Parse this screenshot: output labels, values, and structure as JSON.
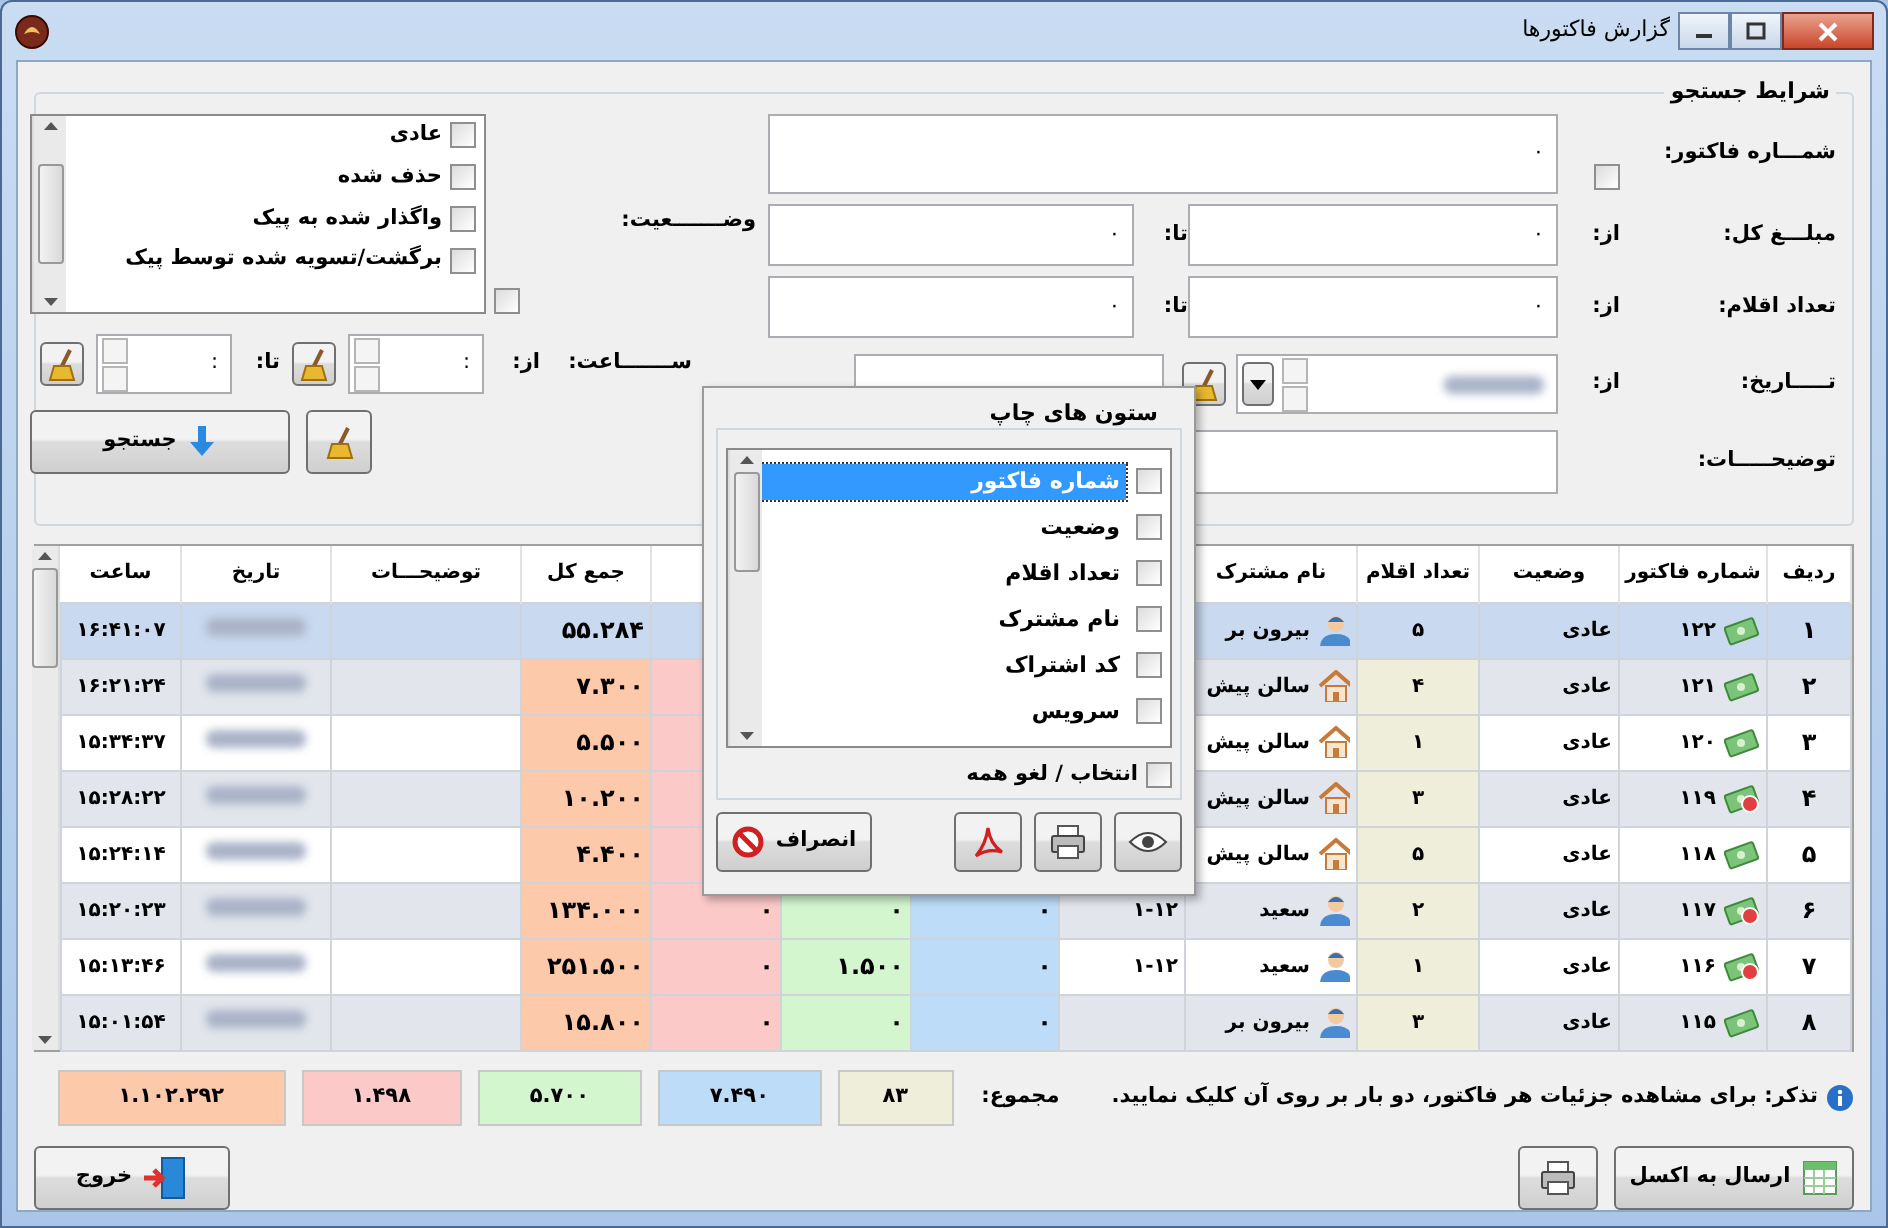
{
  "window": {
    "title": "گزارش فاکتورها"
  },
  "search": {
    "title": "شرایط جستجو",
    "invoice_number": {
      "label": "شمـــاره فاکتور:",
      "value": "۰",
      "checked": false
    },
    "total_amount": {
      "label": "مبلـــغ کل:",
      "from_label": "از:",
      "from": "۰",
      "to_label": "تا:",
      "to": "۰"
    },
    "item_count": {
      "label": "تعداد اقلام:",
      "from_label": "از:",
      "from": "۰",
      "to_label": "تا:",
      "to": "۰"
    },
    "date": {
      "label": "تـــــاریخ:",
      "from_label": "از:"
    },
    "description": {
      "label": "توضیحـــــات:"
    },
    "status": {
      "label": "وضـــــــعیت:",
      "checked": false,
      "options": [
        {
          "label": "عادی",
          "checked": false
        },
        {
          "label": "حذف شده",
          "checked": false
        },
        {
          "label": "واگذار شده به پیک",
          "checked": false
        },
        {
          "label": "برگشت/تسویه شده توسط پیک",
          "checked": false
        }
      ]
    },
    "time": {
      "label": "ســـــــاعت:",
      "from_label": "از:",
      "from": ":",
      "to_label": "تا:",
      "to": ":"
    },
    "search_button": "جستجو"
  },
  "table": {
    "columns": [
      "ردیف",
      "شماره فاکتور",
      "وضعیت",
      "تعداد اقلام",
      "نام مشترک",
      "جمع کل",
      "توضیحـــات",
      "تاریخ",
      "ساعت"
    ],
    "rows": [
      {
        "row": "۱",
        "number": "۱۲۲",
        "alert": false,
        "status": "عادی",
        "count": "۵",
        "customer": "بیرون بر",
        "kind": "person",
        "total": "۵۵.۲۸۴",
        "time": "۱۶:۴۱:۰۷",
        "selected": true
      },
      {
        "row": "۲",
        "number": "۱۲۱",
        "alert": false,
        "status": "عادی",
        "count": "۴",
        "customer": "سالن پیش",
        "kind": "house",
        "total": "۷.۳۰۰",
        "time": "۱۶:۲۱:۲۴",
        "selected": false
      },
      {
        "row": "۳",
        "number": "۱۲۰",
        "alert": false,
        "status": "عادی",
        "count": "۱",
        "customer": "سالن پیش",
        "kind": "house",
        "total": "۵.۵۰۰",
        "time": "۱۵:۳۴:۳۷",
        "selected": false
      },
      {
        "row": "۴",
        "number": "۱۱۹",
        "alert": true,
        "status": "عادی",
        "count": "۳",
        "customer": "سالن پیش",
        "kind": "house",
        "total": "۱۰.۲۰۰",
        "time": "۱۵:۲۸:۲۲",
        "selected": false
      },
      {
        "row": "۵",
        "number": "۱۱۸",
        "alert": false,
        "status": "عادی",
        "count": "۵",
        "customer": "سالن پیش",
        "kind": "house",
        "total": "۴.۴۰۰",
        "time": "۱۵:۲۴:۱۴",
        "selected": false
      },
      {
        "row": "۶",
        "number": "۱۱۷",
        "alert": true,
        "status": "عادی",
        "count": "۲",
        "customer": "سعید",
        "kind": "person",
        "column_5": "۱-۱۲",
        "column_6": "۰",
        "column_7": "۰",
        "column_8": "۰",
        "total": "۱۳۴.۰۰۰",
        "time": "۱۵:۲۰:۲۳",
        "selected": false
      },
      {
        "row": "۷",
        "number": "۱۱۶",
        "alert": true,
        "status": "عادی",
        "count": "۱",
        "customer": "سعید",
        "kind": "person",
        "column_5": "۱-۱۲",
        "column_6": "۰",
        "column_7": "۱.۵۰۰",
        "column_8": "۰",
        "total": "۲۵۱.۵۰۰",
        "time": "۱۵:۱۳:۴۶",
        "selected": false
      },
      {
        "row": "۸",
        "number": "۱۱۵",
        "alert": false,
        "status": "عادی",
        "count": "۳",
        "customer": "بیرون بر",
        "kind": "person",
        "column_6": "۰",
        "column_7": "۰",
        "column_8": "۰",
        "total": "۱۵.۸۰۰",
        "time": "۱۵:۰۱:۵۴",
        "selected": false
      }
    ]
  },
  "summary": {
    "hint": "تذکر: برای مشاهده جزئیات هر فاکتور، دو بار بر روی آن کلیک نمایید.",
    "label": "مجموع:",
    "values": [
      "۸۳",
      "۷.۴۹۰",
      "۵.۷۰۰",
      "۱.۴۹۸",
      "۱.۱۰۲.۲۹۲"
    ]
  },
  "footer": {
    "excel_button": "ارسال به اکسل",
    "exit_button": "خروج"
  },
  "print_columns": {
    "title": "ستون های چاپ",
    "items": [
      {
        "label": "شماره فاکتور",
        "checked": false,
        "selected": true
      },
      {
        "label": "وضعیت",
        "checked": false,
        "selected": false
      },
      {
        "label": "تعداد اقلام",
        "checked": false,
        "selected": false
      },
      {
        "label": "نام مشترک",
        "checked": false,
        "selected": false
      },
      {
        "label": "کد اشتراک",
        "checked": false,
        "selected": false
      },
      {
        "label": "سرویس",
        "checked": false,
        "selected": false
      }
    ],
    "select_all": {
      "label": "انتخاب / لغو همه",
      "checked": false
    },
    "cancel_button": "انصراف"
  }
}
